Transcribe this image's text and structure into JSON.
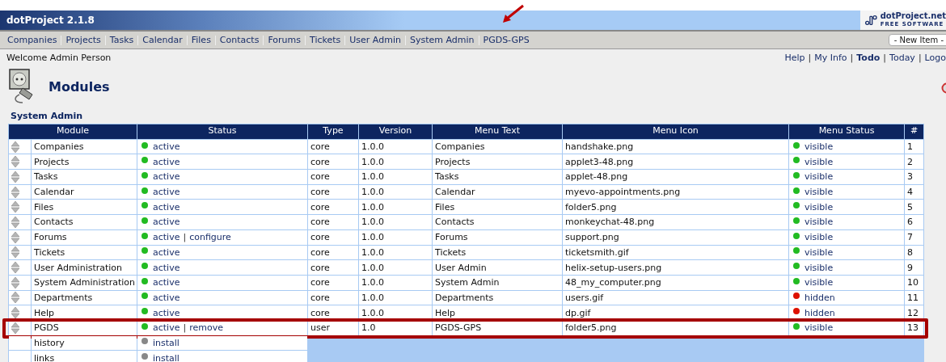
{
  "header": {
    "title": "dotProject 2.1.8",
    "logo_name": "dotProject.net",
    "logo_tagline": "FREE SOFTWARE"
  },
  "nav": {
    "items": [
      "Companies",
      "Projects",
      "Tasks",
      "Calendar",
      "Files",
      "Contacts",
      "Forums",
      "Tickets",
      "User Admin",
      "System Admin",
      "PGDS-GPS"
    ],
    "new_item": "- New Item -"
  },
  "welcome": "Welcome Admin Person",
  "user_links": {
    "separator": "|",
    "items": [
      {
        "label": "Help",
        "bold": false
      },
      {
        "label": "My Info",
        "bold": false
      },
      {
        "label": "Todo",
        "bold": true
      },
      {
        "label": "Today",
        "bold": false
      },
      {
        "label": "Logo",
        "bold": false
      }
    ]
  },
  "page": {
    "title": "Modules",
    "breadcrumb": "System Admin"
  },
  "table": {
    "columns": [
      "Module",
      "Status",
      "Type",
      "Version",
      "Menu Text",
      "Menu Icon",
      "Menu Status",
      "#"
    ],
    "rows": [
      {
        "kind": "installed",
        "name": "Companies",
        "status": {
          "color": "#22bb22",
          "links": [
            "active"
          ]
        },
        "type": "core",
        "version": "1.0.0",
        "menu_text": "Companies",
        "menu_icon": "handshake.png",
        "menu_status": {
          "label": "visible",
          "color": "#22bb22"
        },
        "order": "1",
        "highlighted": false
      },
      {
        "kind": "installed",
        "name": "Projects",
        "status": {
          "color": "#22bb22",
          "links": [
            "active"
          ]
        },
        "type": "core",
        "version": "1.0.0",
        "menu_text": "Projects",
        "menu_icon": "applet3-48.png",
        "menu_status": {
          "label": "visible",
          "color": "#22bb22"
        },
        "order": "2",
        "highlighted": false
      },
      {
        "kind": "installed",
        "name": "Tasks",
        "status": {
          "color": "#22bb22",
          "links": [
            "active"
          ]
        },
        "type": "core",
        "version": "1.0.0",
        "menu_text": "Tasks",
        "menu_icon": "applet-48.png",
        "menu_status": {
          "label": "visible",
          "color": "#22bb22"
        },
        "order": "3",
        "highlighted": false
      },
      {
        "kind": "installed",
        "name": "Calendar",
        "status": {
          "color": "#22bb22",
          "links": [
            "active"
          ]
        },
        "type": "core",
        "version": "1.0.0",
        "menu_text": "Calendar",
        "menu_icon": "myevo-appointments.png",
        "menu_status": {
          "label": "visible",
          "color": "#22bb22"
        },
        "order": "4",
        "highlighted": false
      },
      {
        "kind": "installed",
        "name": "Files",
        "status": {
          "color": "#22bb22",
          "links": [
            "active"
          ]
        },
        "type": "core",
        "version": "1.0.0",
        "menu_text": "Files",
        "menu_icon": "folder5.png",
        "menu_status": {
          "label": "visible",
          "color": "#22bb22"
        },
        "order": "5",
        "highlighted": false
      },
      {
        "kind": "installed",
        "name": "Contacts",
        "status": {
          "color": "#22bb22",
          "links": [
            "active"
          ]
        },
        "type": "core",
        "version": "1.0.0",
        "menu_text": "Contacts",
        "menu_icon": "monkeychat-48.png",
        "menu_status": {
          "label": "visible",
          "color": "#22bb22"
        },
        "order": "6",
        "highlighted": false
      },
      {
        "kind": "installed",
        "name": "Forums",
        "status": {
          "color": "#22bb22",
          "links": [
            "active",
            "configure"
          ],
          "separator": "|"
        },
        "type": "core",
        "version": "1.0.0",
        "menu_text": "Forums",
        "menu_icon": "support.png",
        "menu_status": {
          "label": "visible",
          "color": "#22bb22"
        },
        "order": "7",
        "highlighted": false
      },
      {
        "kind": "installed",
        "name": "Tickets",
        "status": {
          "color": "#22bb22",
          "links": [
            "active"
          ]
        },
        "type": "core",
        "version": "1.0.0",
        "menu_text": "Tickets",
        "menu_icon": "ticketsmith.gif",
        "menu_status": {
          "label": "visible",
          "color": "#22bb22"
        },
        "order": "8",
        "highlighted": false
      },
      {
        "kind": "installed",
        "name": "User Administration",
        "status": {
          "color": "#22bb22",
          "links": [
            "active"
          ]
        },
        "type": "core",
        "version": "1.0.0",
        "menu_text": "User Admin",
        "menu_icon": "helix-setup-users.png",
        "menu_status": {
          "label": "visible",
          "color": "#22bb22"
        },
        "order": "9",
        "highlighted": false
      },
      {
        "kind": "installed",
        "name": "System Administration",
        "status": {
          "color": "#22bb22",
          "links": [
            "active"
          ]
        },
        "type": "core",
        "version": "1.0.0",
        "menu_text": "System Admin",
        "menu_icon": "48_my_computer.png",
        "menu_status": {
          "label": "visible",
          "color": "#22bb22"
        },
        "order": "10",
        "highlighted": false
      },
      {
        "kind": "installed",
        "name": "Departments",
        "status": {
          "color": "#22bb22",
          "links": [
            "active"
          ]
        },
        "type": "core",
        "version": "1.0.0",
        "menu_text": "Departments",
        "menu_icon": "users.gif",
        "menu_status": {
          "label": "hidden",
          "color": "#dd1100"
        },
        "order": "11",
        "highlighted": false
      },
      {
        "kind": "installed",
        "name": "Help",
        "status": {
          "color": "#22bb22",
          "links": [
            "active"
          ]
        },
        "type": "core",
        "version": "1.0.0",
        "menu_text": "Help",
        "menu_icon": "dp.gif",
        "menu_status": {
          "label": "hidden",
          "color": "#dd1100"
        },
        "order": "12",
        "highlighted": false
      },
      {
        "kind": "installed",
        "name": "PGDS",
        "status": {
          "color": "#22bb22",
          "links": [
            "active",
            "remove"
          ],
          "separator": "|"
        },
        "type": "user",
        "version": "1.0",
        "menu_text": "PGDS-GPS",
        "menu_icon": "folder5.png",
        "menu_status": {
          "label": "visible",
          "color": "#22bb22"
        },
        "order": "13",
        "highlighted": true
      },
      {
        "kind": "available",
        "name": "history",
        "status": {
          "color": "#888888",
          "links": [
            "install"
          ]
        },
        "highlighted": false
      },
      {
        "kind": "available",
        "name": "links",
        "status": {
          "color": "#888888",
          "links": [
            "install"
          ]
        },
        "highlighted": false
      }
    ]
  }
}
